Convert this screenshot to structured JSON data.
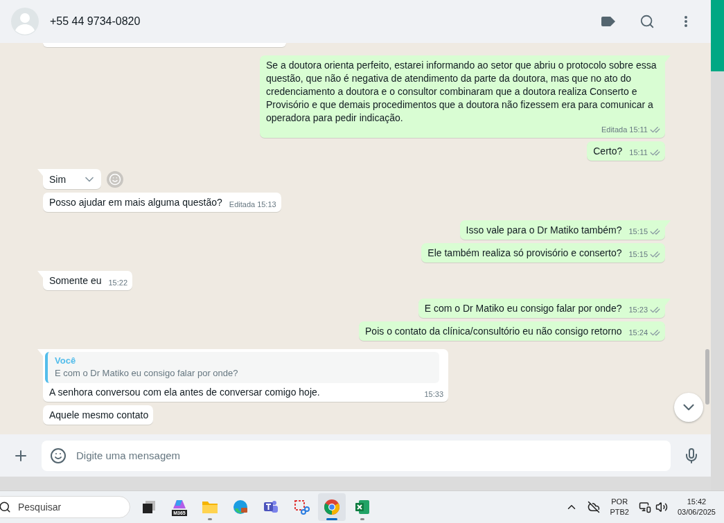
{
  "chat_header": {
    "contact": "+55 44 9734-0820"
  },
  "messages": [
    {
      "kind": "cut",
      "outgoing": false
    },
    {
      "kind": "text",
      "outgoing": true,
      "tail": true,
      "text": "Se a doutora orienta perfeito, estarei informando ao setor que abriu o protocolo sobre essa questão, que não é negativa de atendimento da parte da doutora, mas que no ato do credenciamento a doutora e o consultor combinaram que a doutora realiza Conserto e Provisório e que demais procedimentos que a doutora não fizessem era para comunicar a operadora para pedir indicação.",
      "edited": "Editada",
      "time": "15:11",
      "ticks": true
    },
    {
      "kind": "text",
      "outgoing": true,
      "tail": false,
      "text": "Certo?",
      "time": "15:11",
      "ticks": true
    },
    {
      "kind": "hover",
      "outgoing": false,
      "tail": true,
      "text": "Sim"
    },
    {
      "kind": "text",
      "outgoing": false,
      "tail": false,
      "text": "Posso ajudar em mais alguma questão?",
      "edited": "Editada",
      "time": "15:13",
      "ticks": false
    },
    {
      "kind": "text",
      "outgoing": true,
      "tail": true,
      "text": "Isso vale para o Dr Matiko também?",
      "time": "15:15",
      "ticks": true
    },
    {
      "kind": "text",
      "outgoing": true,
      "tail": false,
      "text": "Ele também realiza só provisório e conserto?",
      "time": "15:15",
      "ticks": true
    },
    {
      "kind": "text",
      "outgoing": false,
      "tail": true,
      "text": "Somente eu",
      "time": "15:22",
      "ticks": false
    },
    {
      "kind": "text",
      "outgoing": true,
      "tail": true,
      "text": "E com o Dr Matiko eu consigo falar por onde?",
      "time": "15:23",
      "ticks": true
    },
    {
      "kind": "text",
      "outgoing": true,
      "tail": false,
      "text": "Pois o contato da clínica/consultório eu não consigo retorno",
      "time": "15:24",
      "ticks": true
    },
    {
      "kind": "reply",
      "outgoing": false,
      "tail": true,
      "quote_author": "Você",
      "quote_text": "E com o Dr Matiko eu consigo falar por onde?",
      "text": "A senhora conversou com ela antes de conversar comigo hoje.",
      "time": "15:33",
      "ticks": false
    },
    {
      "kind": "text",
      "outgoing": false,
      "tail": false,
      "text": "Aquele mesmo contato"
    }
  ],
  "composer": {
    "placeholder": "Digite uma mensagem"
  },
  "taskbar": {
    "search": {
      "placeholder": "Pesquisar"
    },
    "apps": [
      {
        "kind": "taskview",
        "running": false,
        "active": false
      },
      {
        "kind": "m365",
        "label": "M365",
        "running": false,
        "active": false
      },
      {
        "kind": "folder",
        "running": true,
        "active": false
      },
      {
        "kind": "edge",
        "running": false,
        "active": false
      },
      {
        "kind": "teams",
        "running": false,
        "active": false
      },
      {
        "kind": "snip",
        "running": false,
        "active": false
      },
      {
        "kind": "chrome",
        "running": true,
        "active": true
      },
      {
        "kind": "excel",
        "running": true,
        "active": false
      }
    ],
    "language": "POR",
    "layout": "PTB2",
    "time": "15:42",
    "date": "03/06/2025"
  }
}
